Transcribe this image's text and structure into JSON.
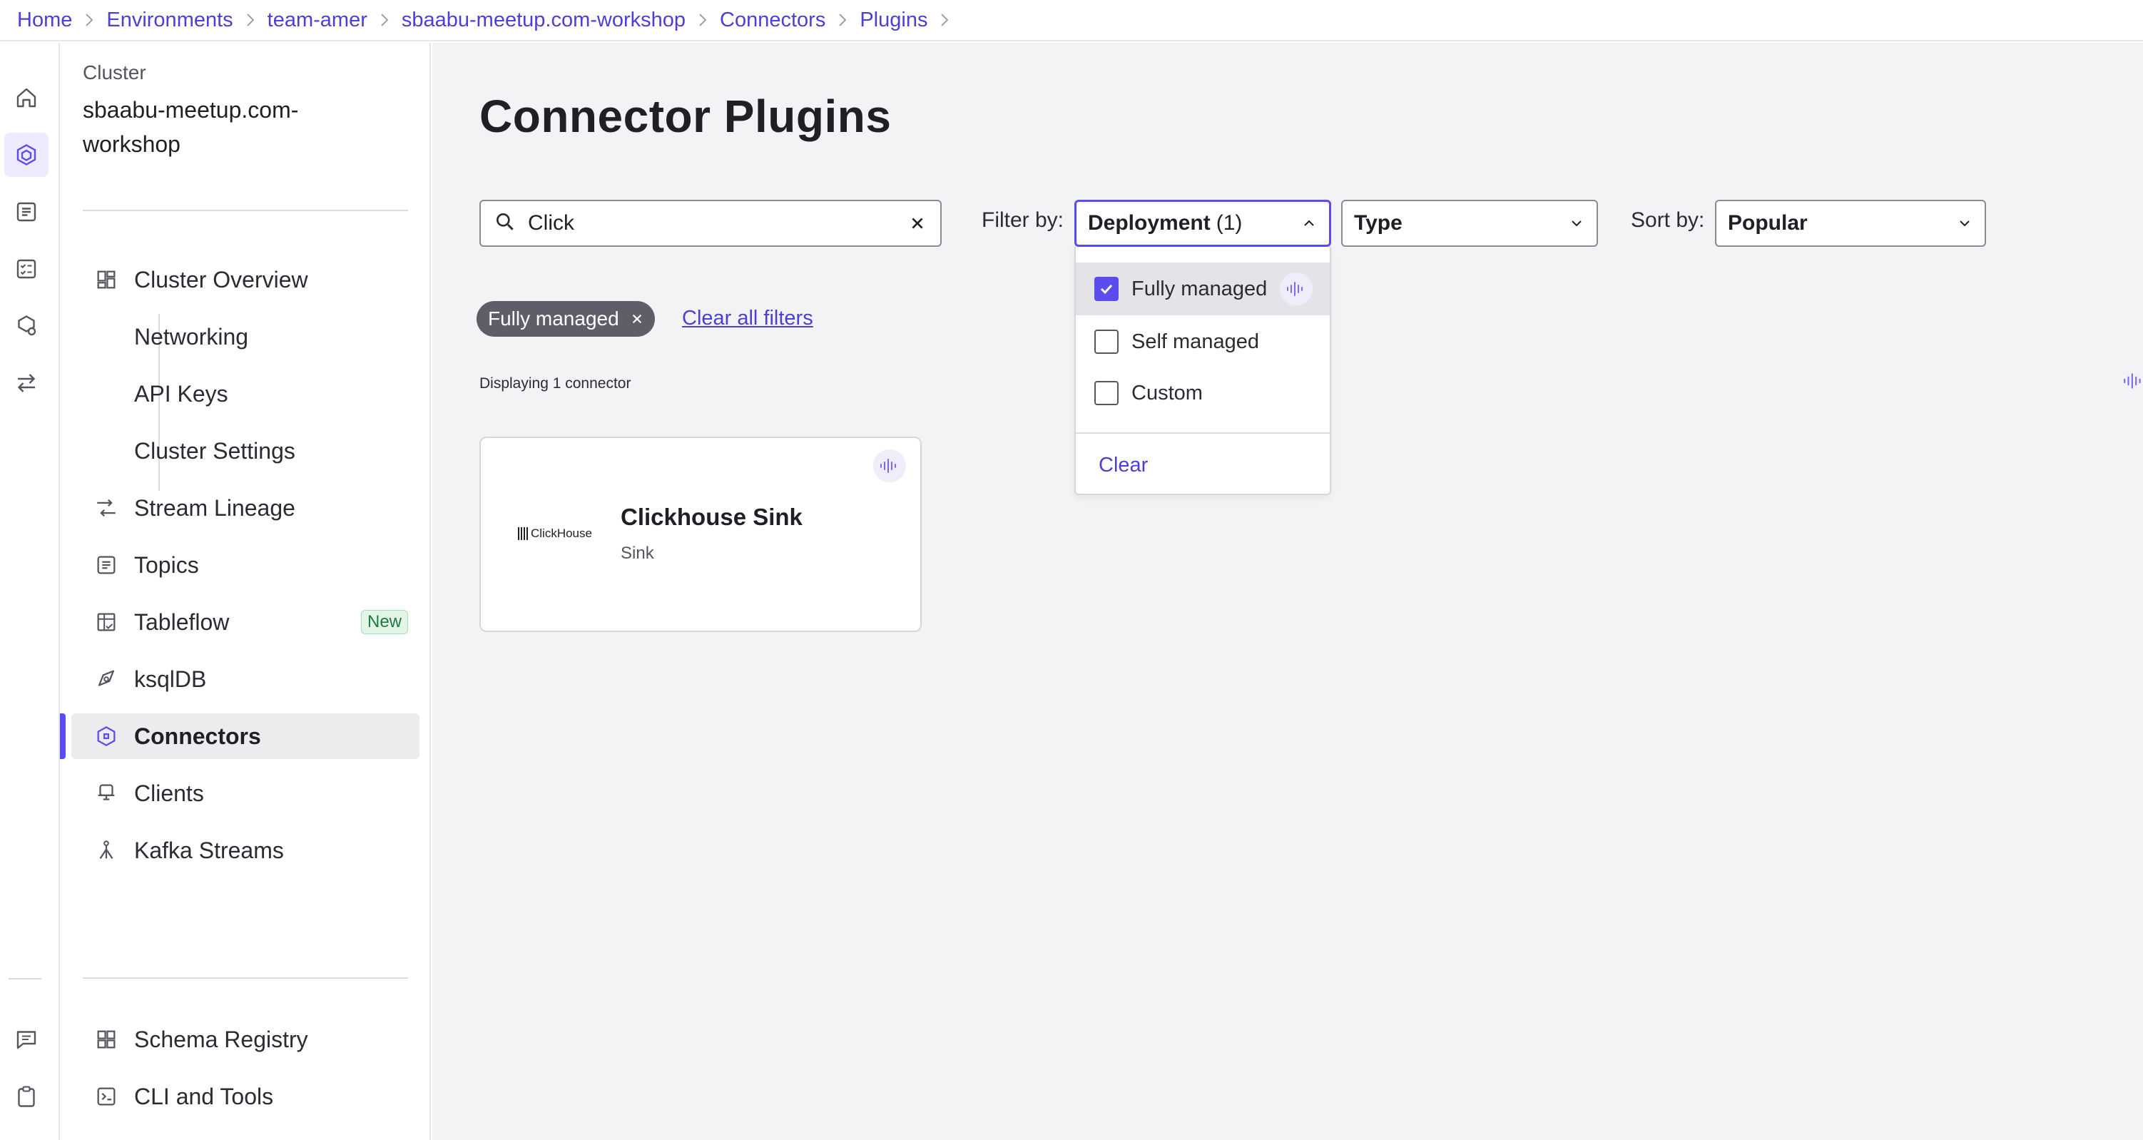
{
  "breadcrumb": [
    "Home",
    "Environments",
    "team-amer",
    "sbaabu-meetup.com-workshop",
    "Connectors",
    "Plugins"
  ],
  "sidebar": {
    "section_label": "Cluster",
    "cluster_name": "sbaabu-meetup.com-workshop",
    "items": [
      {
        "label": "Cluster Overview",
        "icon": "dashboard-icon"
      },
      {
        "label": "Networking",
        "icon": ""
      },
      {
        "label": "API Keys",
        "icon": ""
      },
      {
        "label": "Cluster Settings",
        "icon": ""
      },
      {
        "label": "Stream Lineage",
        "icon": "lineage-icon"
      },
      {
        "label": "Topics",
        "icon": "topics-icon"
      },
      {
        "label": "Tableflow",
        "icon": "tableflow-icon",
        "badge": "New"
      },
      {
        "label": "ksqlDB",
        "icon": "ksqldb-icon"
      },
      {
        "label": "Connectors",
        "icon": "connectors-icon",
        "active": true
      },
      {
        "label": "Clients",
        "icon": "clients-icon"
      },
      {
        "label": "Kafka Streams",
        "icon": "kafka-streams-icon"
      }
    ],
    "bottom_items": [
      {
        "label": "Schema Registry",
        "icon": "schema-registry-icon"
      },
      {
        "label": "CLI and Tools",
        "icon": "cli-icon"
      }
    ]
  },
  "main": {
    "title": "Connector Plugins",
    "search": {
      "value": "Click",
      "placeholder": "Search"
    },
    "filter_label": "Filter by:",
    "deployment_select": {
      "label": "Deployment",
      "count": "(1)"
    },
    "type_select": {
      "label": "Type"
    },
    "sort_label": "Sort by:",
    "sort_select": {
      "label": "Popular"
    },
    "active_chip": "Fully managed",
    "clear_all": "Clear all filters",
    "display_count": "Displaying 1 connector",
    "connectors": [
      {
        "name": "Clickhouse Sink",
        "type": "Sink",
        "logo_text": "ClickHouse"
      }
    ],
    "dropdown": {
      "options": [
        {
          "label": "Fully managed",
          "checked": true
        },
        {
          "label": "Self managed",
          "checked": false
        },
        {
          "label": "Custom",
          "checked": false
        }
      ],
      "clear": "Clear"
    }
  },
  "colors": {
    "accent": "#5b4cf0",
    "link": "#4b3fd8",
    "chip": "#5e5e68"
  }
}
